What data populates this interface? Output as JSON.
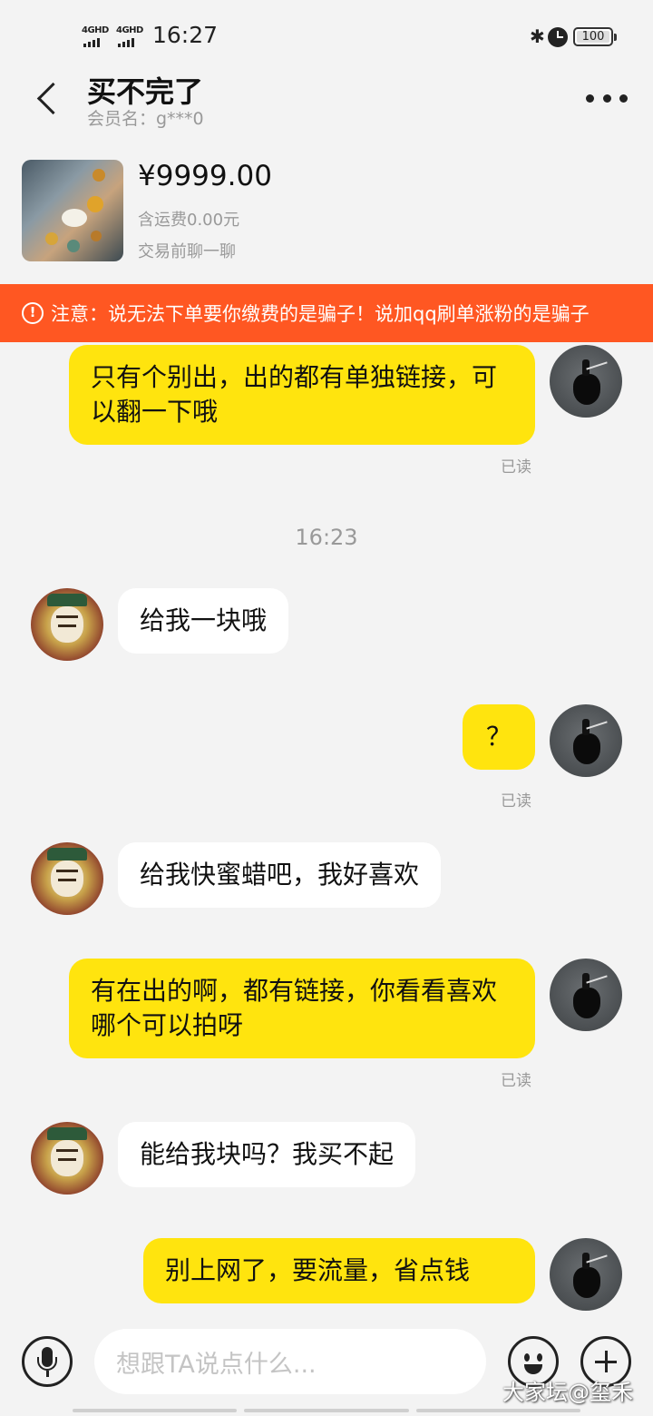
{
  "status_bar": {
    "signal1": "4GHD",
    "signal2": "4GHD",
    "time": "16:27",
    "battery": "100"
  },
  "header": {
    "title": "买不完了",
    "member": "会员名：g***0"
  },
  "product": {
    "price": "¥9999.00",
    "shipping": "含运费0.00元",
    "chat_before": "交易前聊一聊"
  },
  "warning": {
    "text": "注意：说无法下单要你缴费的是骗子！说加qq刷单涨粉的是骗子"
  },
  "messages": [
    {
      "side": "mine",
      "text": "只有个别出，出的都有单独链接，可以翻一下哦",
      "read": "已读"
    },
    {
      "side": "theirs",
      "text": "给我一块哦"
    },
    {
      "side": "mine",
      "text": "？",
      "read": "已读"
    },
    {
      "side": "theirs",
      "text": "给我快蜜蜡吧，我好喜欢"
    },
    {
      "side": "mine",
      "text": "有在出的啊，都有链接，你看看喜欢哪个可以拍呀",
      "read": "已读"
    },
    {
      "side": "theirs",
      "text": "能给我块吗？我买不起"
    },
    {
      "side": "mine",
      "text": "别上网了，要流量，省点钱"
    }
  ],
  "timestamp": "16:23",
  "input": {
    "placeholder": "想跟TA说点什么..."
  },
  "watermark": "大家坛@玺禾",
  "colors": {
    "mine_bubble": "#ffe40e",
    "theirs_bubble": "#ffffff",
    "warning_bg": "#ff5722",
    "background": "#f3f3f3"
  },
  "icons": [
    "back-arrow-icon",
    "more-icon",
    "alert-icon",
    "mic-icon",
    "emoji-icon",
    "plus-icon",
    "bluetooth-icon",
    "alarm-icon",
    "battery-icon"
  ]
}
